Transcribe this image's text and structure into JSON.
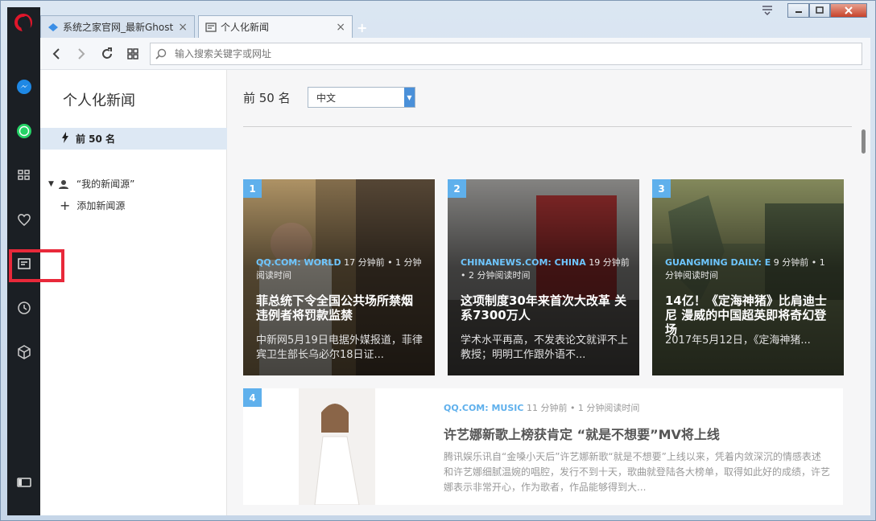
{
  "tabs": [
    {
      "label": "系统之家官网_最新Ghost",
      "icon": "site-icon"
    },
    {
      "label": "个人化新闻",
      "icon": "news-icon"
    }
  ],
  "toolbar": {
    "search_placeholder": "输入搜索关键字或网址"
  },
  "sidebar_icons": [
    "messenger-icon",
    "whatsapp-icon",
    "speed-dial-icon",
    "heart-icon",
    "news-icon",
    "history-icon",
    "extensions-icon",
    "sidebar-toggle-icon"
  ],
  "left_panel": {
    "title": "个人化新闻",
    "top_item": "前 50 名",
    "my_sources": "“我的新闻源”",
    "add_source": "添加新闻源"
  },
  "main": {
    "header": "前 50 名",
    "language": "中文",
    "cards": [
      {
        "num": "1",
        "source": "QQ.COM: WORLD",
        "time": "17 分钟前 • 1 分钟阅读时间",
        "title": "菲总统下令全国公共场所禁烟 违例者将罚款监禁",
        "summary": "中新网5月19日电据外媒报道，菲律宾卫生部长乌必尔18日证..."
      },
      {
        "num": "2",
        "source": "CHINANEWS.COM: CHINA",
        "time": "19 分钟前 • 2 分钟阅读时间",
        "title": "这项制度30年来首次大改革 关系7300万人",
        "summary": "学术水平再高，不发表论文就评不上教授；明明工作跟外语不..."
      },
      {
        "num": "3",
        "source": "GUANGMING DAILY: E",
        "time": "9 分钟前 • 1 分钟阅读时间",
        "title": "14亿！《定海神猪》比肩迪士尼 漫威的中国超英即将奇幻登场",
        "summary": "2017年5月12日，《定海神猪..."
      }
    ],
    "wide_card": {
      "num": "4",
      "source": "QQ.COM: MUSIC",
      "time": "11 分钟前 • 1 分钟阅读时间",
      "title": "许艺娜新歌上榜获肯定 “就是不想要”MV将上线",
      "summary": "腾讯娱乐讯自“金嗓小天后”许艺娜新歌“就是不想要”上线以来，凭着内敛深沉的情感表述和许艺娜细腻温婉的唱腔，发行不到十天，歌曲就登陆各大榜单，取得如此好的成绩，许艺娜表示非常开心，作为歌者，作品能够得到大..."
    }
  },
  "colors": {
    "accent": "#5fb0ec",
    "highlight": "#e8293a",
    "sidebar": "#1b1f24"
  }
}
